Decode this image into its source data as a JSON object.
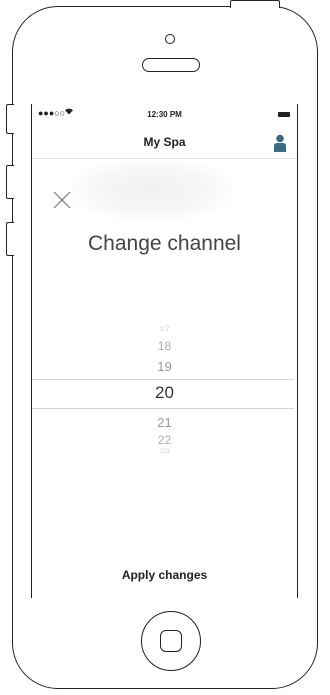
{
  "status_bar": {
    "signal": "●●●○○",
    "time": "12:30 PM"
  },
  "nav": {
    "title": "My Spa"
  },
  "modal": {
    "title": "Change channel"
  },
  "picker": {
    "items": [
      "17",
      "18",
      "19",
      "20",
      "21",
      "22",
      "23"
    ],
    "selected_value": "20"
  },
  "apply_button": {
    "label": "Apply changes"
  },
  "icons": {
    "wifi": "wifi-icon",
    "battery": "battery-icon",
    "profile": "profile-icon",
    "close": "close-icon"
  },
  "colors": {
    "accent": "#3a6b86"
  }
}
